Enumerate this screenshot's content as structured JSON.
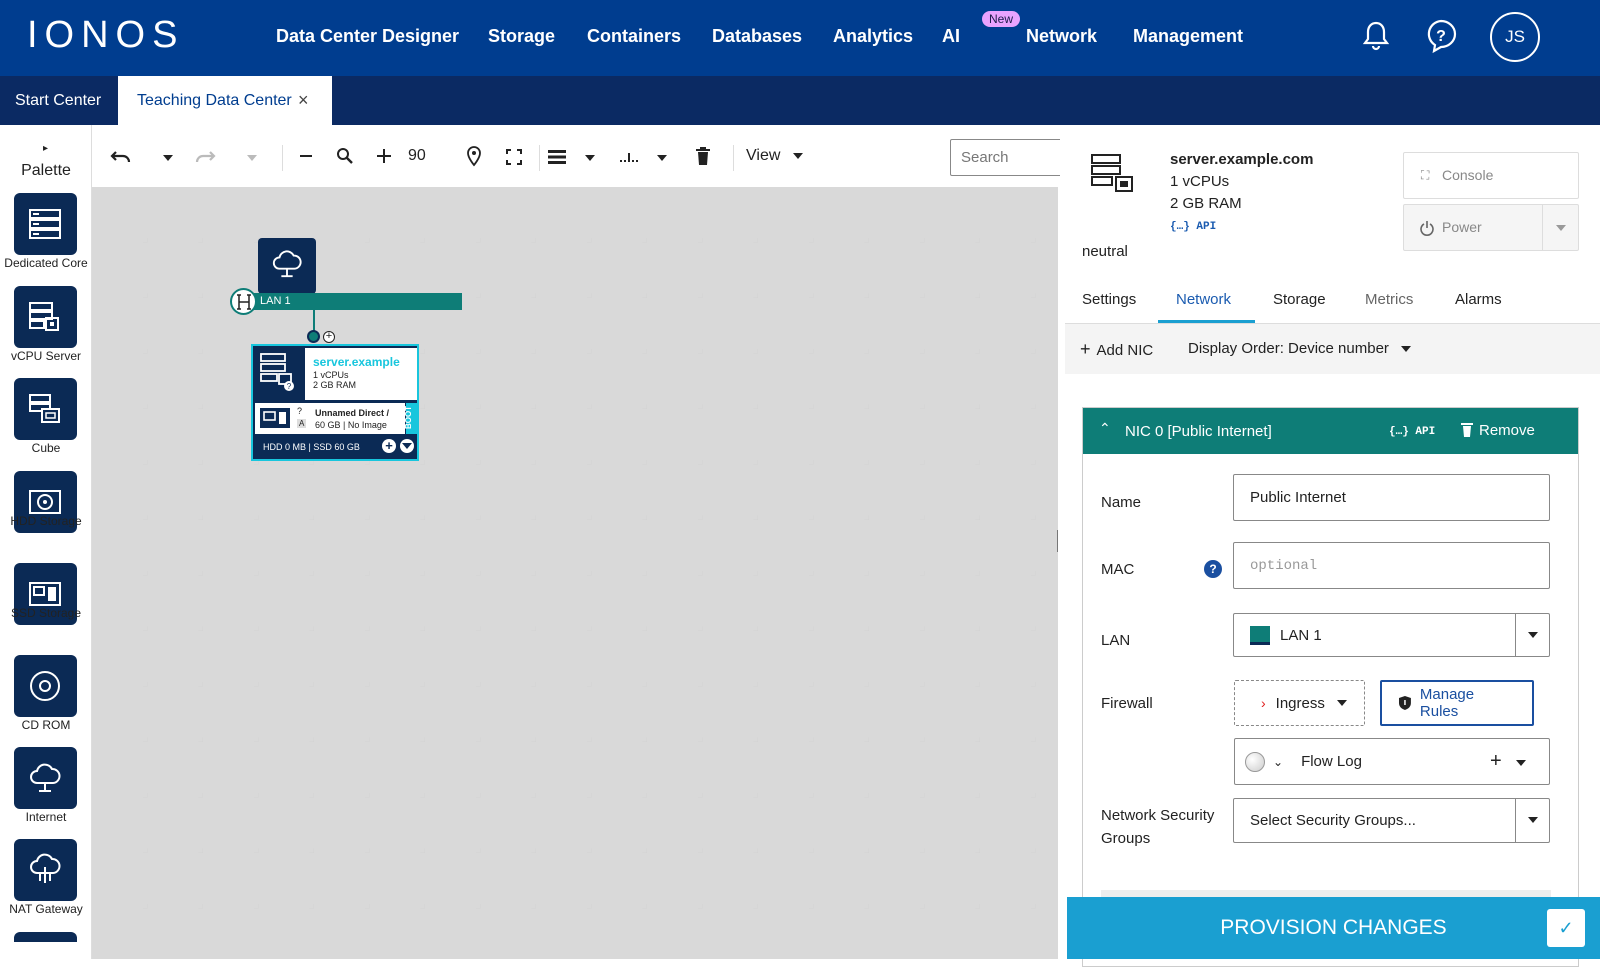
{
  "brand": "IONOS",
  "nav": [
    {
      "label": "Data Center Designer"
    },
    {
      "label": "Storage"
    },
    {
      "label": "Containers"
    },
    {
      "label": "Databases"
    },
    {
      "label": "Analytics"
    },
    {
      "label": "AI"
    },
    {
      "label": "Network"
    },
    {
      "label": "Management"
    }
  ],
  "new_badge": "New",
  "user_initials": "JS",
  "tabs": {
    "start": "Start Center",
    "active": "Teaching Data Center",
    "close": "×"
  },
  "palette": {
    "title": "Palette",
    "items": [
      {
        "label": "Dedicated Core",
        "icon": "server-icon"
      },
      {
        "label": "vCPU Server",
        "icon": "vcpu-server-icon"
      },
      {
        "label": "Cube",
        "icon": "cube-icon"
      },
      {
        "label": "HDD Storage",
        "icon": "hdd-icon"
      },
      {
        "label": "SSD Storage",
        "icon": "ssd-icon"
      },
      {
        "label": "CD ROM",
        "icon": "cd-icon"
      },
      {
        "label": "Internet",
        "icon": "cloud-icon"
      },
      {
        "label": "NAT Gateway",
        "icon": "nat-gateway-icon"
      }
    ]
  },
  "toolbar": {
    "zoom": "90",
    "view": "View",
    "search_placeholder": "Search"
  },
  "canvas": {
    "lan_label": "LAN 1",
    "server_title": "server.example",
    "server_vcpus": "1 vCPUs",
    "server_ram": "2 GB RAM",
    "storage_q": "?",
    "storage_a": "A",
    "storage_name": "Unnamed Direct /",
    "storage_info": "60 GB | No Image",
    "boot": "BOOT",
    "server_footer": "HDD 0 MB | SSD 60 GB"
  },
  "details": {
    "name": "server.example.com",
    "vcpus": "1 vCPUs",
    "ram": "2 GB RAM",
    "api": "{…} API",
    "state": "neutral",
    "console": "Console",
    "power": "Power"
  },
  "detail_tabs": [
    "Settings",
    "Network",
    "Storage",
    "Metrics",
    "Alarms"
  ],
  "active_detail_tab": "Network",
  "nic_toolbar": {
    "add": "Add NIC",
    "order": "Display Order: Device number"
  },
  "nic": {
    "header": "NIC 0 [Public Internet]",
    "api": "{…} API",
    "remove": "Remove",
    "name_label": "Name",
    "name_value": "Public Internet",
    "mac_label": "MAC",
    "mac_placeholder": "optional",
    "lan_label": "LAN",
    "lan_value": "LAN 1",
    "firewall_label": "Firewall",
    "firewall_mode": "Ingress",
    "manage_rules": "Manage Rules",
    "flow_log": "Flow Log",
    "nsg_label": "Network Security Groups",
    "nsg_placeholder": "Select Security Groups..."
  },
  "provision": "PROVISION CHANGES",
  "colors": {
    "nav": "#003d8f",
    "tabbar": "#0b2a63",
    "teal": "#0e7d77",
    "accent": "#1a9fd1",
    "cyan": "#18c6dd"
  }
}
